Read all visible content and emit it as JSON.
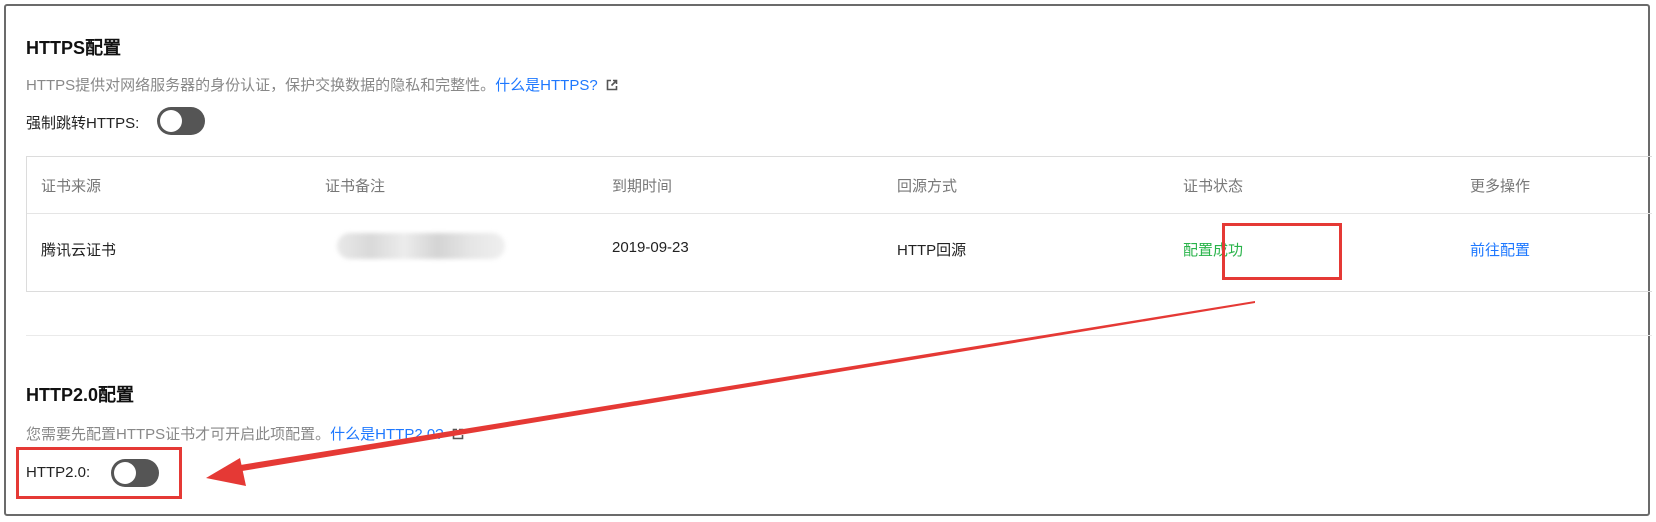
{
  "https_section": {
    "title": "HTTPS配置",
    "description": "HTTPS提供对网络服务器的身份认证，保护交换数据的隐私和完整性。",
    "help_link": "什么是HTTPS?",
    "force_redirect_label": "强制跳转HTTPS:",
    "force_redirect_enabled": false
  },
  "certificate_table": {
    "columns": [
      "证书来源",
      "证书备注",
      "到期时间",
      "回源方式",
      "证书状态",
      "更多操作"
    ],
    "rows": [
      {
        "source": "腾讯云证书",
        "note": "",
        "expiry": "2019-09-23",
        "origin_method": "HTTP回源",
        "status": "配置成功",
        "action": "前往配置"
      }
    ]
  },
  "http2_section": {
    "title": "HTTP2.0配置",
    "description": "您需要先配置HTTPS证书才可开启此项配置。",
    "help_link": "什么是HTTP2.0?",
    "toggle_label": "HTTP2.0:",
    "toggle_enabled": false
  },
  "colors": {
    "link": "#1e78ff",
    "success": "#29b34a",
    "annotation": "#e53935",
    "toggle_off": "#555555"
  },
  "icons": {
    "external_link": "external-link-icon"
  }
}
